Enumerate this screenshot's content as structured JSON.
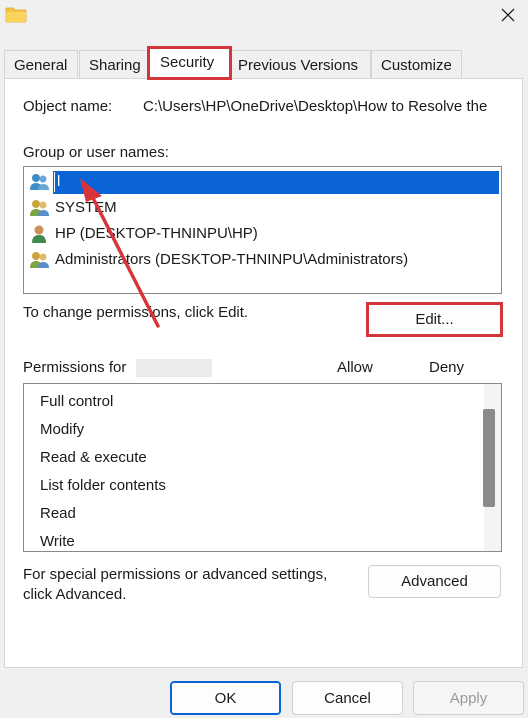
{
  "titlebar": {
    "folder_icon": "folder-icon",
    "close_icon": "close-icon",
    "close_glyph": "✕"
  },
  "tabs": [
    {
      "label": "General",
      "active": false
    },
    {
      "label": "Sharing",
      "active": false
    },
    {
      "label": "Security",
      "active": true
    },
    {
      "label": "Previous Versions",
      "active": false
    },
    {
      "label": "Customize",
      "active": false
    }
  ],
  "object_name": {
    "label": "Object name:",
    "value": "C:\\Users\\HP\\OneDrive\\Desktop\\How to Resolve the"
  },
  "group_users": {
    "label": "Group or user names:",
    "items": [
      {
        "name": "l",
        "icon": "user-group-icon",
        "selected": true
      },
      {
        "name": "SYSTEM",
        "icon": "user-group-icon",
        "selected": false
      },
      {
        "name": "HP (DESKTOP-THNINPU\\HP)",
        "icon": "user-icon",
        "selected": false
      },
      {
        "name": "Administrators (DESKTOP-THNINPU\\Administrators)",
        "icon": "user-group-icon",
        "selected": false
      }
    ]
  },
  "change_permissions": {
    "text": "To change permissions, click Edit.",
    "edit_label": "Edit..."
  },
  "permissions": {
    "header_label": "Permissions for",
    "allow_label": "Allow",
    "deny_label": "Deny",
    "items": [
      "Full control",
      "Modify",
      "Read & execute",
      "List folder contents",
      "Read",
      "Write"
    ]
  },
  "special": {
    "text_line1": "For special permissions or advanced settings,",
    "text_line2": "click Advanced.",
    "advanced_label": "Advanced"
  },
  "footer": {
    "ok_label": "OK",
    "cancel_label": "Cancel",
    "apply_label": "Apply"
  },
  "colors": {
    "accent": "#0a64d6",
    "highlight_red": "#d4353b",
    "annotation_arrow": "#d9343a"
  }
}
